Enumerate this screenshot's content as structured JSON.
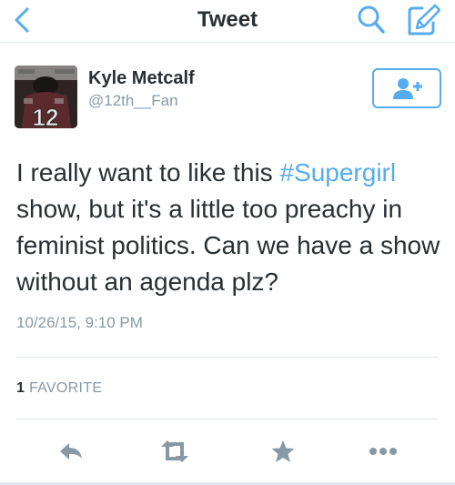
{
  "nav": {
    "title": "Tweet",
    "back_icon": "chevron-left-icon",
    "search_icon": "search-icon",
    "compose_icon": "compose-icon"
  },
  "tweet": {
    "author_name": "Kyle Metcalf",
    "author_handle": "@12th__Fan",
    "avatar_jersey_number": "12",
    "text_before_hashtag": "I really want to like this ",
    "hashtag": "#Supergirl",
    "text_after_hashtag": " show, but it's a little too preachy in feminist politics. Can we have a show without an agenda plz?",
    "timestamp": "10/26/15, 9:10 PM"
  },
  "stats": {
    "favorite_count": "1",
    "favorite_label": "FAVORITE"
  },
  "actions": [
    {
      "name": "reply",
      "icon": "reply-icon"
    },
    {
      "name": "retweet",
      "icon": "retweet-icon"
    },
    {
      "name": "favorite",
      "icon": "star-icon"
    },
    {
      "name": "more",
      "icon": "more-dots-icon"
    }
  ],
  "colors": {
    "accent": "#55acee",
    "text": "#292f33",
    "muted": "#8899a6",
    "divider": "#e1e8ed",
    "action_icon": "#8899a6"
  }
}
